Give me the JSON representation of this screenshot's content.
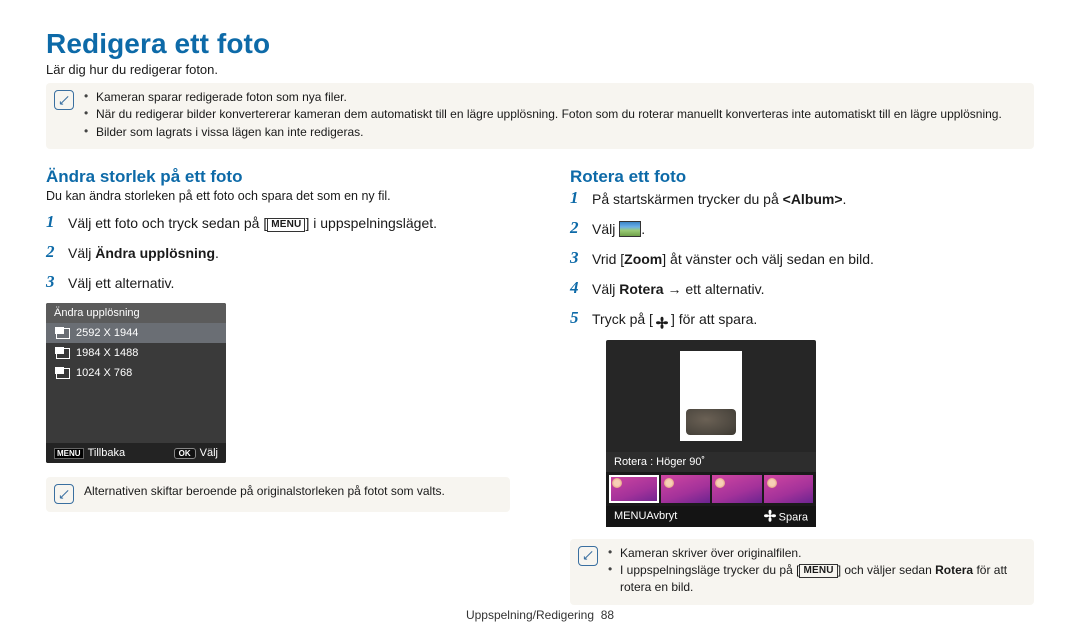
{
  "page": {
    "title": "Redigera ett foto",
    "intro": "Lär dig hur du redigerar foton.",
    "footer_section": "Uppspelning/Redigering",
    "footer_page": "88"
  },
  "top_note": [
    "Kameran sparar redigerade foton som nya filer.",
    "När du redigerar bilder konvertererar kameran dem automatiskt till en lägre upplösning. Foton som du roterar manuellt konverteras inte automatiskt till en lägre upplösning.",
    "Bilder som lagrats i vissa lägen kan inte redigeras."
  ],
  "left": {
    "heading": "Ändra storlek på ett foto",
    "sub": "Du kan ändra storleken på ett foto och spara det som en ny fil.",
    "step1_pre": "Välj ett foto och tryck sedan på [",
    "step1_post": "] i uppspelningsläget.",
    "step2_pre": "Välj ",
    "step2_bold": "Ändra upplösning",
    "step2_post": ".",
    "step3": "Välj ett alternativ.",
    "menu_header": "Ändra upplösning",
    "menu": [
      "2592 X 1944",
      "1984 X 1488",
      "1024 X 768"
    ],
    "menu_back": "Tillbaka",
    "menu_select": "Välj",
    "note": "Alternativen skiftar beroende på originalstorleken på fotot som valts."
  },
  "right": {
    "heading": "Rotera ett foto",
    "step1_pre": "På startskärmen trycker du på ",
    "step1_bold": "<Album>",
    "step1_post": ".",
    "step2": "Välj ",
    "step3_pre": "Vrid [",
    "step3_bold1": "Zoom",
    "step3_mid": "] åt vänster och välj sedan en bild.",
    "step4_pre": "Välj ",
    "step4_bold": "Rotera",
    "step4_post": " → ett alternativ.",
    "step5_pre": "Tryck på [",
    "step5_post": "] för att spara.",
    "preview_label": "Rotera : Höger 90˚",
    "preview_back": "Avbryt",
    "preview_save": "Spara",
    "note": [
      "Kameran skriver över originalfilen.",
      "I uppspelningsläge trycker du på [MENU] och väljer sedan Rotera för att rotera en bild."
    ],
    "note2_pre": "I uppspelningsläge trycker du på [",
    "note2_mid": "] och väljer sedan ",
    "note2_bold": "Rotera",
    "note2_post": " för att rotera en bild."
  },
  "labels": {
    "menu": "MENU",
    "ok": "OK"
  }
}
